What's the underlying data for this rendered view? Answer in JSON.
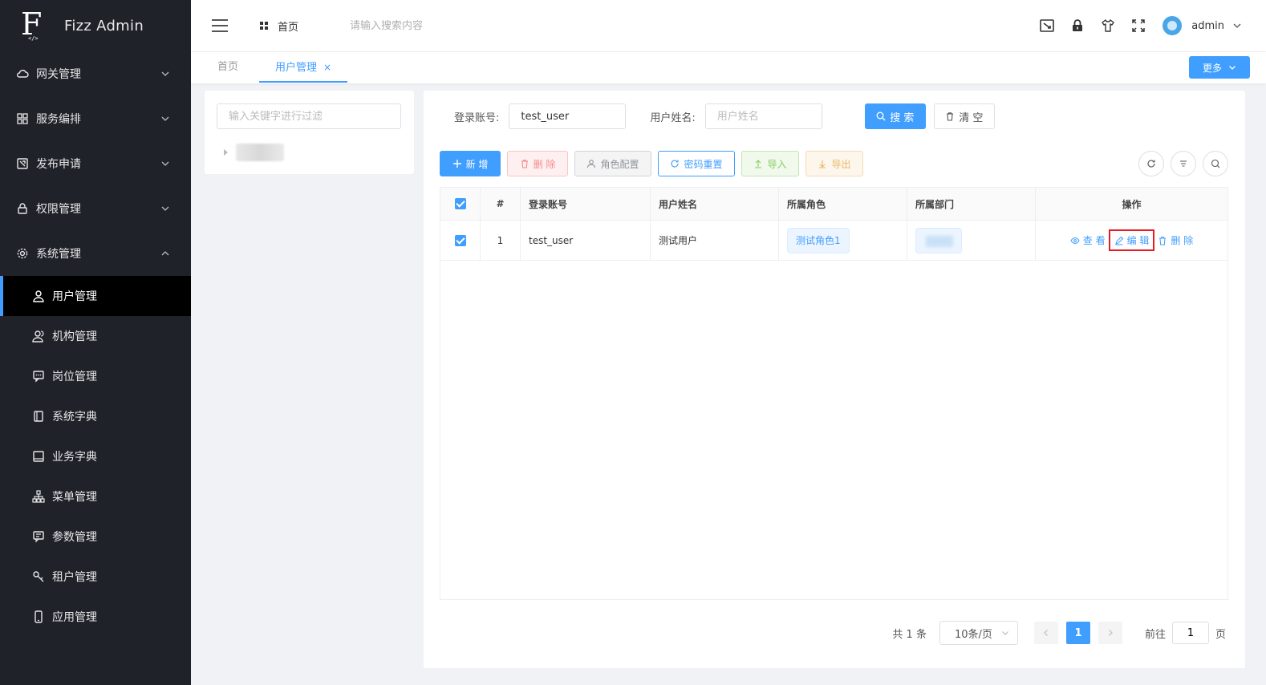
{
  "app": {
    "logo_letter": "F",
    "logo_sub": "</>",
    "title": "Fizz Admin"
  },
  "sidebar": {
    "groups": [
      {
        "label": "网关管理",
        "icon": "cloud-icon",
        "expanded": false
      },
      {
        "label": "服务编排",
        "icon": "grid-icon",
        "expanded": false
      },
      {
        "label": "发布申请",
        "icon": "publish-icon",
        "expanded": false
      },
      {
        "label": "权限管理",
        "icon": "lock-icon",
        "expanded": false
      },
      {
        "label": "系统管理",
        "icon": "gear-icon",
        "expanded": true
      }
    ],
    "sub_items": [
      {
        "label": "用户管理",
        "icon": "user-icon",
        "active": true
      },
      {
        "label": "机构管理",
        "icon": "org-icon",
        "active": false
      },
      {
        "label": "岗位管理",
        "icon": "chat-icon",
        "active": false
      },
      {
        "label": "系统字典",
        "icon": "dict-icon",
        "active": false
      },
      {
        "label": "业务字典",
        "icon": "book-icon",
        "active": false
      },
      {
        "label": "菜单管理",
        "icon": "tree-icon",
        "active": false
      },
      {
        "label": "参数管理",
        "icon": "message-icon",
        "active": false
      },
      {
        "label": "租户管理",
        "icon": "key-icon",
        "active": false
      },
      {
        "label": "应用管理",
        "icon": "mobile-icon",
        "active": false
      }
    ]
  },
  "header": {
    "home_label": "首页",
    "search_placeholder": "请输入搜索内容",
    "user_name": "admin"
  },
  "tabs": {
    "items": [
      {
        "label": "首页",
        "active": false
      },
      {
        "label": "用户管理",
        "active": true,
        "close": "×"
      }
    ],
    "more_label": "更多"
  },
  "tree": {
    "filter_placeholder": "输入关键字进行过滤"
  },
  "search_form": {
    "account_label": "登录账号:",
    "account_value": "test_user",
    "name_label": "用户姓名:",
    "name_placeholder": "用户姓名",
    "search_label": "搜 索",
    "clear_label": "清 空"
  },
  "toolbar": {
    "add_label": "新 增",
    "delete_label": "删 除",
    "role_label": "角色配置",
    "pwd_reset_label": "密码重置",
    "import_label": "导入",
    "export_label": "导出"
  },
  "table": {
    "columns": [
      "#",
      "登录账号",
      "用户姓名",
      "所属角色",
      "所属部门",
      "操作"
    ],
    "rows": [
      {
        "index": "1",
        "account": "test_user",
        "name": "测试用户",
        "role": "测试角色1",
        "checked": true
      }
    ],
    "actions": {
      "view": "查 看",
      "edit": "编 辑",
      "delete": "删 除"
    }
  },
  "pagination": {
    "total": "共 1 条",
    "page_size": "10条/页",
    "current": "1",
    "goto_label": "前往",
    "goto_value": "1",
    "goto_unit": "页"
  },
  "colors": {
    "primary": "#409eff",
    "sidebar_bg": "#20222a",
    "highlight": "#e51c23"
  }
}
